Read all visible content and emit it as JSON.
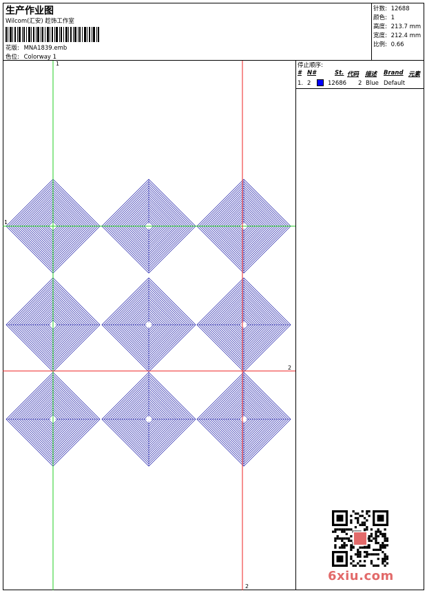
{
  "header": {
    "title": "生产作业图",
    "company": "Wilcom(汇安) 趁饰工作室",
    "design_label": "花版:",
    "design_value": "MNA1839.emb",
    "colorway_label": "色位:",
    "colorway_value": "Colorway 1"
  },
  "stats": [
    {
      "label": "针数:",
      "value": "12688"
    },
    {
      "label": "颜色:",
      "value": "1"
    },
    {
      "label": "高度:",
      "value": "213.7 mm"
    },
    {
      "label": "宽度:",
      "value": "212.4 mm"
    },
    {
      "label": "比例:",
      "value": "0.66"
    }
  ],
  "sequence": {
    "title": "停止顺序:",
    "headers": [
      "#",
      "N#",
      "St.",
      "代码",
      "描述",
      "Brand",
      "元素"
    ],
    "rows": [
      {
        "index": "1.",
        "needle": "2",
        "color": "#0000ff",
        "stitches": "12686",
        "code": "2",
        "desc": "Blue",
        "brand": "Default",
        "element": ""
      }
    ]
  },
  "axis_labels": {
    "green_top": "1",
    "green_left": "1",
    "red_right": "2",
    "red_bottom": "2"
  },
  "watermark": "6xiu.com",
  "colors": {
    "stitch": "#1a1aa8",
    "green_guide": "#22cc22",
    "red_guide": "#ee2222"
  }
}
